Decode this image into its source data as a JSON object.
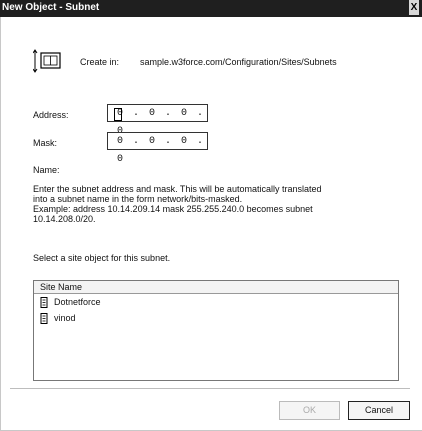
{
  "window": {
    "title": "New Object - Subnet",
    "close_glyph": "X"
  },
  "header": {
    "create_in_label": "Create in:",
    "create_in_path": "sample.w3force.com/Configuration/Sites/Subnets",
    "icon": "subnet-object-icon"
  },
  "form": {
    "address_label": "Address:",
    "address_value": "0 . 0 . 0 . 0",
    "mask_label": "Mask:",
    "mask_value": "0 . 0 . 0 . 0",
    "name_label": "Name:"
  },
  "help_text": {
    "line1": "Enter the subnet address and mask. This will be automatically translated",
    "line2": "into a subnet name in the form network/bits-masked.",
    "line3": "Example: address 10.14.209.14 mask 255.255.240.0 becomes subnet",
    "line4": "10.14.208.0/20."
  },
  "site_select": {
    "instruction": "Select a site object for this subnet.",
    "column_header": "Site Name",
    "items": [
      {
        "label": "Dotnetforce",
        "icon": "site-icon"
      },
      {
        "label": "vinod",
        "icon": "site-icon"
      }
    ]
  },
  "buttons": {
    "ok_label": "OK",
    "cancel_label": "Cancel"
  }
}
